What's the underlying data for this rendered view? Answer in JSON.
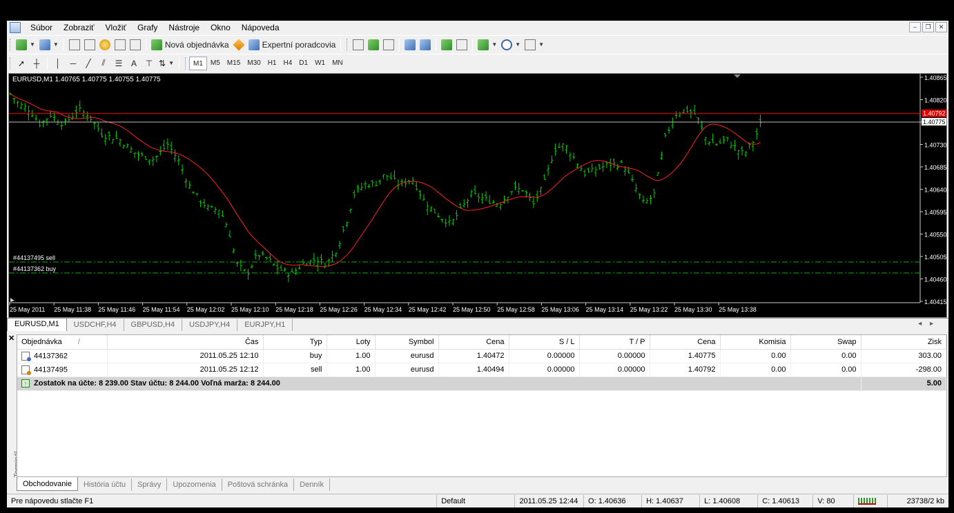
{
  "menu": [
    "Súbor",
    "Zobraziť",
    "Vložiť",
    "Grafy",
    "Nástroje",
    "Okno",
    "Nápoveda"
  ],
  "window_controls": [
    "–",
    "❐",
    "✕"
  ],
  "toolbar": {
    "new_order": "Nová objednávka",
    "expert_advisors": "Expertní poradcovia",
    "timeframes": [
      "M1",
      "M5",
      "M15",
      "M30",
      "H1",
      "H4",
      "D1",
      "W1",
      "MN"
    ],
    "text_tool": "A"
  },
  "chart": {
    "title": "EURUSD,M1  1.40765 1.40775 1.40755 1.40775",
    "price_labels": [
      "1.40865",
      "1.40820",
      "1.40775",
      "1.40730",
      "1.40685",
      "1.40640",
      "1.40595",
      "1.40550",
      "1.40505",
      "1.40460",
      "1.40415"
    ],
    "red_line_label": "1.40792",
    "current_label": "1.40775",
    "time_labels": [
      "25 May 2011",
      "25 May 11:38",
      "25 May 11:46",
      "25 May 11:54",
      "25 May 12:02",
      "25 May 12:10",
      "25 May 12:18",
      "25 May 12:26",
      "25 May 12:34",
      "25 May 12:42",
      "25 May 12:50",
      "25 May 12:58",
      "25 May 13:06",
      "25 May 13:14",
      "25 May 13:22",
      "25 May 13:30",
      "25 May 13:38"
    ],
    "order_lines": [
      {
        "label": "#44137495 sell",
        "price": 1.40494
      },
      {
        "label": "#44137362 buy",
        "price": 1.40472
      }
    ],
    "colors": {
      "bars": "#00d200",
      "ma": "#ff2020",
      "bid": "#ff0000",
      "order": "#00b400"
    }
  },
  "chart_tabs": [
    "EURUSD,M1",
    "USDCHF,H4",
    "GBPUSD,H4",
    "USDJPY,H4",
    "EURJPY,H1"
  ],
  "terminal": {
    "side_label": "Terminál",
    "columns": [
      "Objednávka",
      "Čas",
      "Typ",
      "Loty",
      "Symbol",
      "Cena",
      "S / L",
      "T / P",
      "Cena",
      "Komisia",
      "Swap",
      "Zisk"
    ],
    "sort_mark": "/",
    "rows": [
      {
        "order": "44137362",
        "time": "2011.05.25 12:10",
        "type": "buy",
        "lots": "1.00",
        "symbol": "eurusd",
        "price": "1.40472",
        "sl": "0.00000",
        "tp": "0.00000",
        "cur": "1.40775",
        "commission": "0.00",
        "swap": "0.00",
        "profit": "303.00"
      },
      {
        "order": "44137495",
        "time": "2011.05.25 12:12",
        "type": "sell",
        "lots": "1.00",
        "symbol": "eurusd",
        "price": "1.40494",
        "sl": "0.00000",
        "tp": "0.00000",
        "cur": "1.40792",
        "commission": "0.00",
        "swap": "0.00",
        "profit": "-298.00"
      }
    ],
    "summary": "Zostatok na účte: 8 239.00  Stav účtu: 8 244.00  Voľná marža: 8 244.00",
    "summary_profit": "5.00",
    "tabs": [
      "Obchodovanie",
      "História účtu",
      "Správy",
      "Upozornenia",
      "Poštová schránka",
      "Denník"
    ]
  },
  "status": {
    "help": "Pre nápovedu stlačte F1",
    "profile": "Default",
    "datetime": "2011.05.25 12:44",
    "open": "O: 1.40636",
    "high": "H: 1.40637",
    "low": "L: 1.40608",
    "close": "C: 1.40613",
    "volume": "V: 80",
    "traffic": "23738/2 kb"
  }
}
